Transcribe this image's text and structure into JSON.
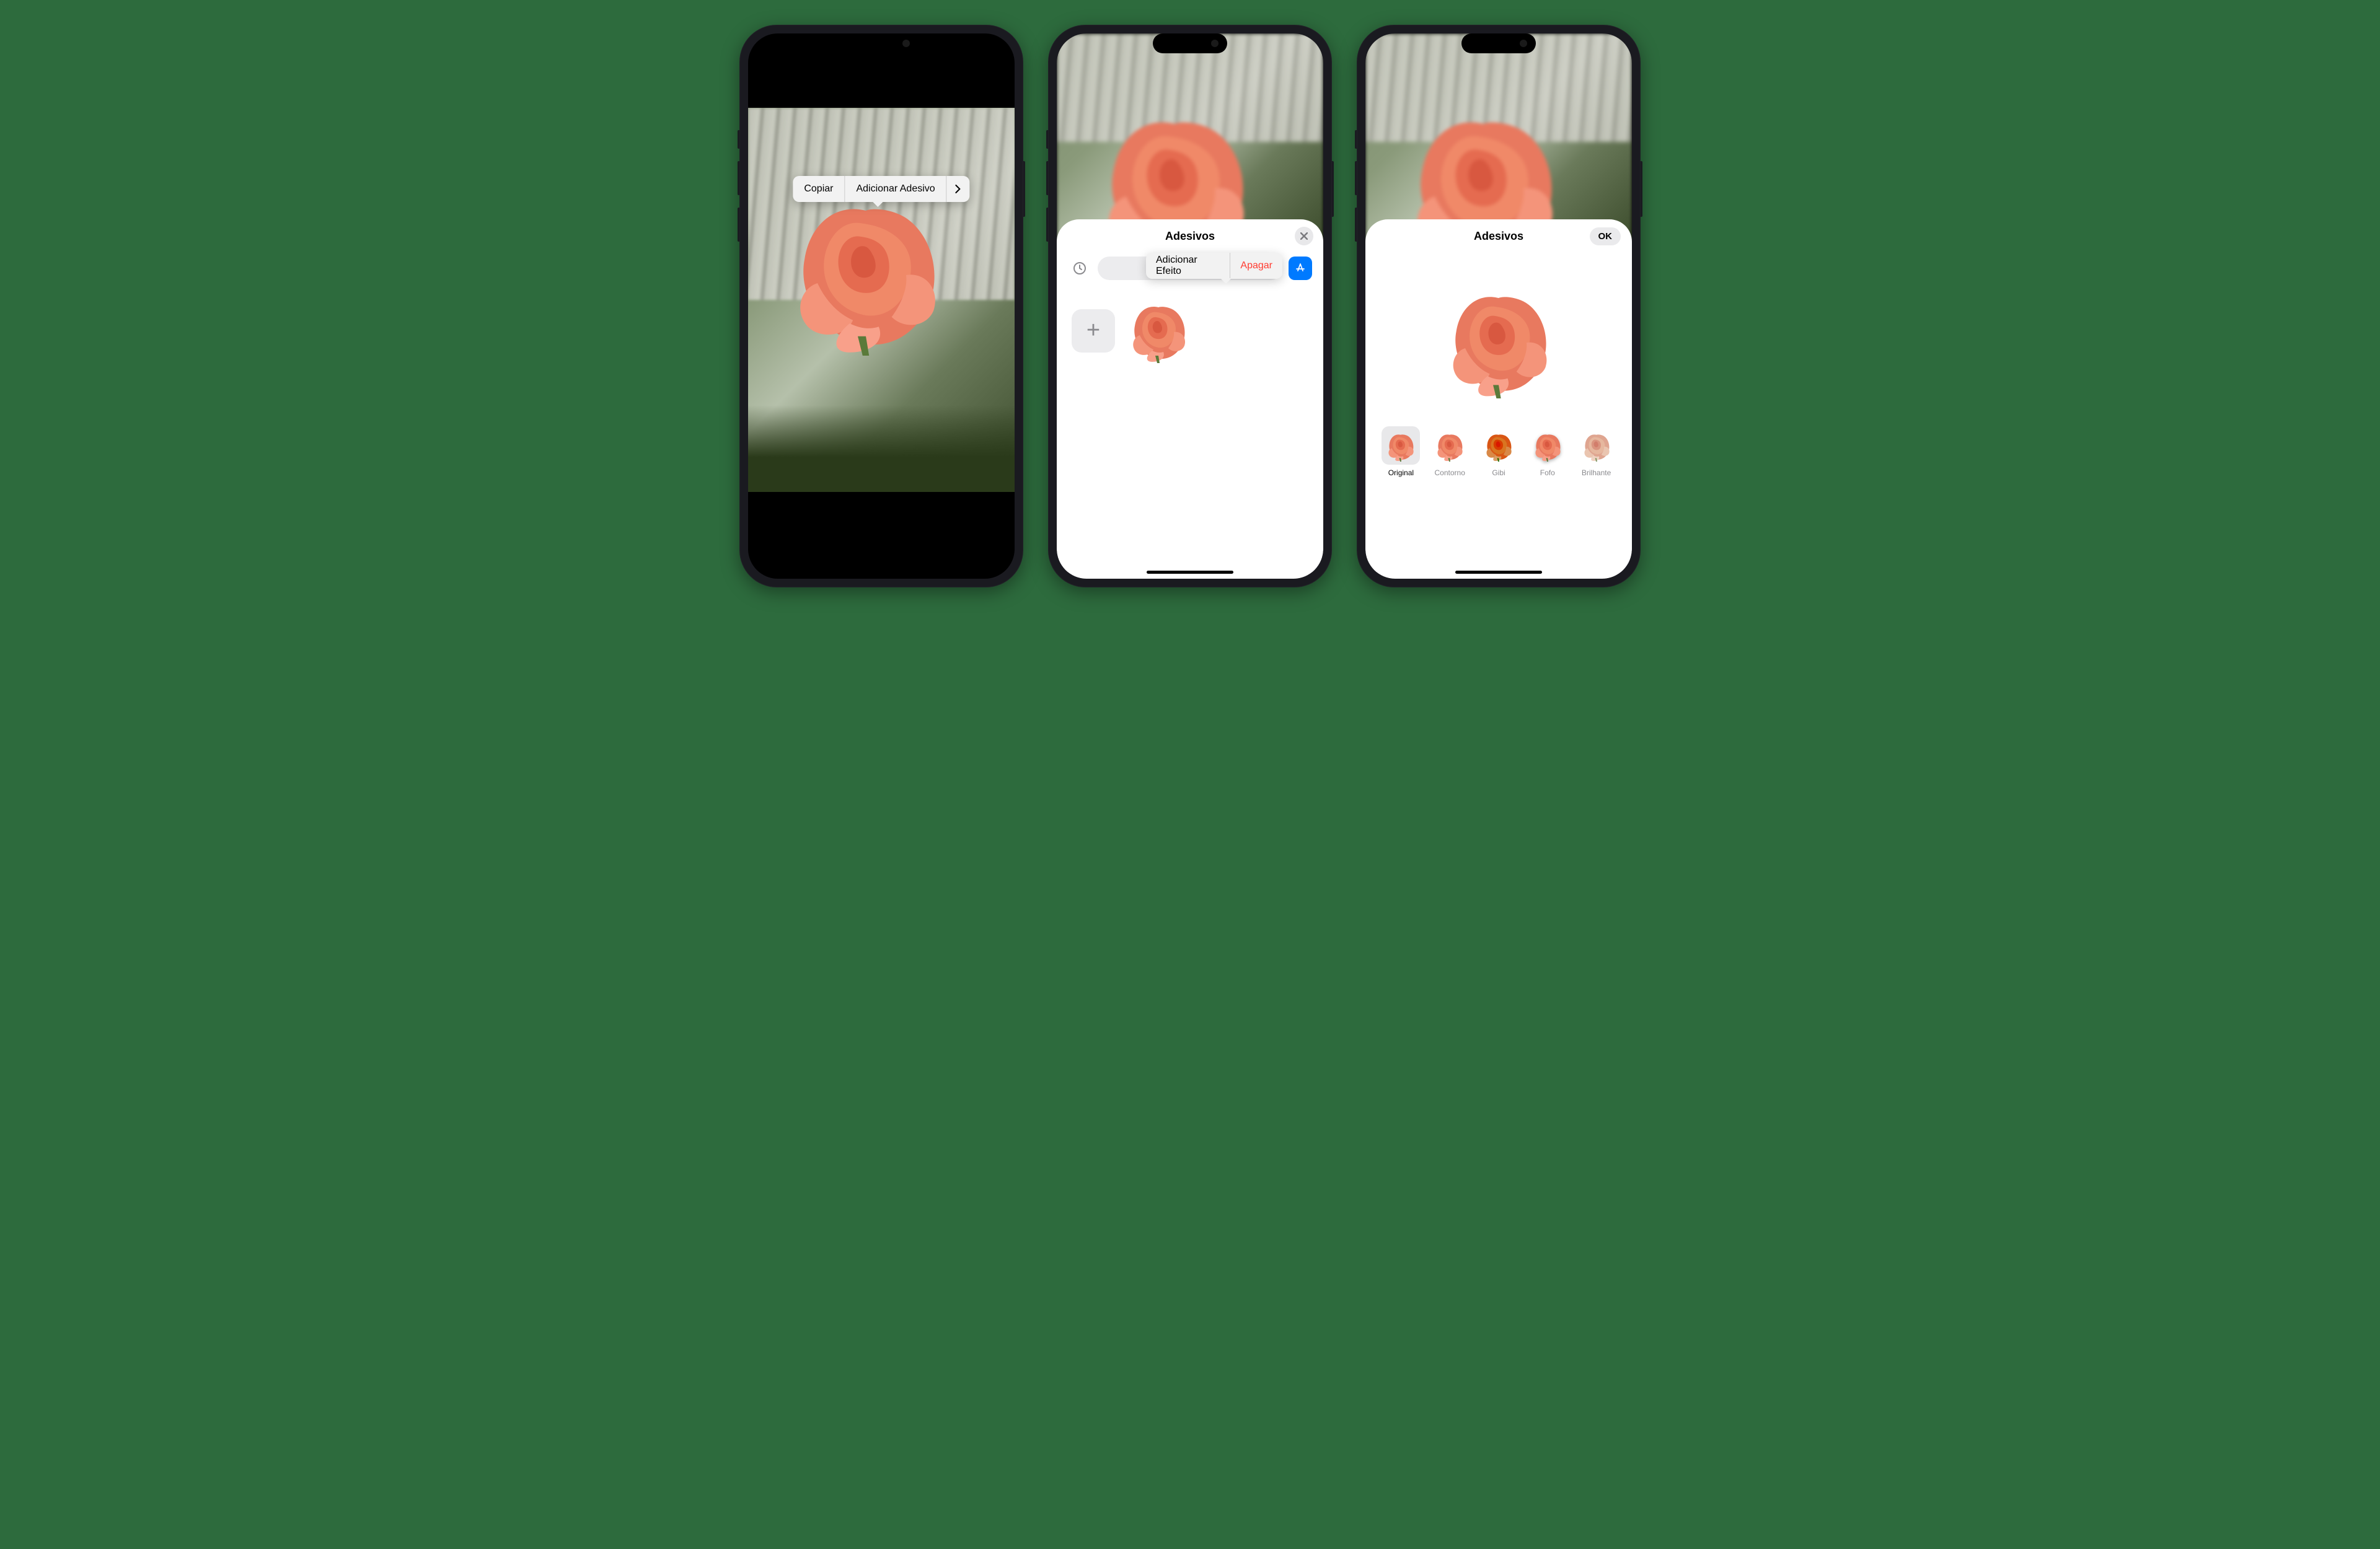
{
  "phone1": {
    "context_menu": {
      "copy": "Copiar",
      "add_sticker": "Adicionar Adesivo"
    }
  },
  "phone2": {
    "sheet_title": "Adesivos",
    "sticker_menu": {
      "add_effect": "Adicionar Efeito",
      "delete": "Apagar"
    }
  },
  "phone3": {
    "sheet_title": "Adesivos",
    "done": "OK",
    "effects": [
      {
        "label": "Original",
        "selected": true
      },
      {
        "label": "Contorno",
        "selected": false
      },
      {
        "label": "Gibi",
        "selected": false
      },
      {
        "label": "Fofo",
        "selected": false
      },
      {
        "label": "Brilhante",
        "selected": false
      }
    ]
  }
}
